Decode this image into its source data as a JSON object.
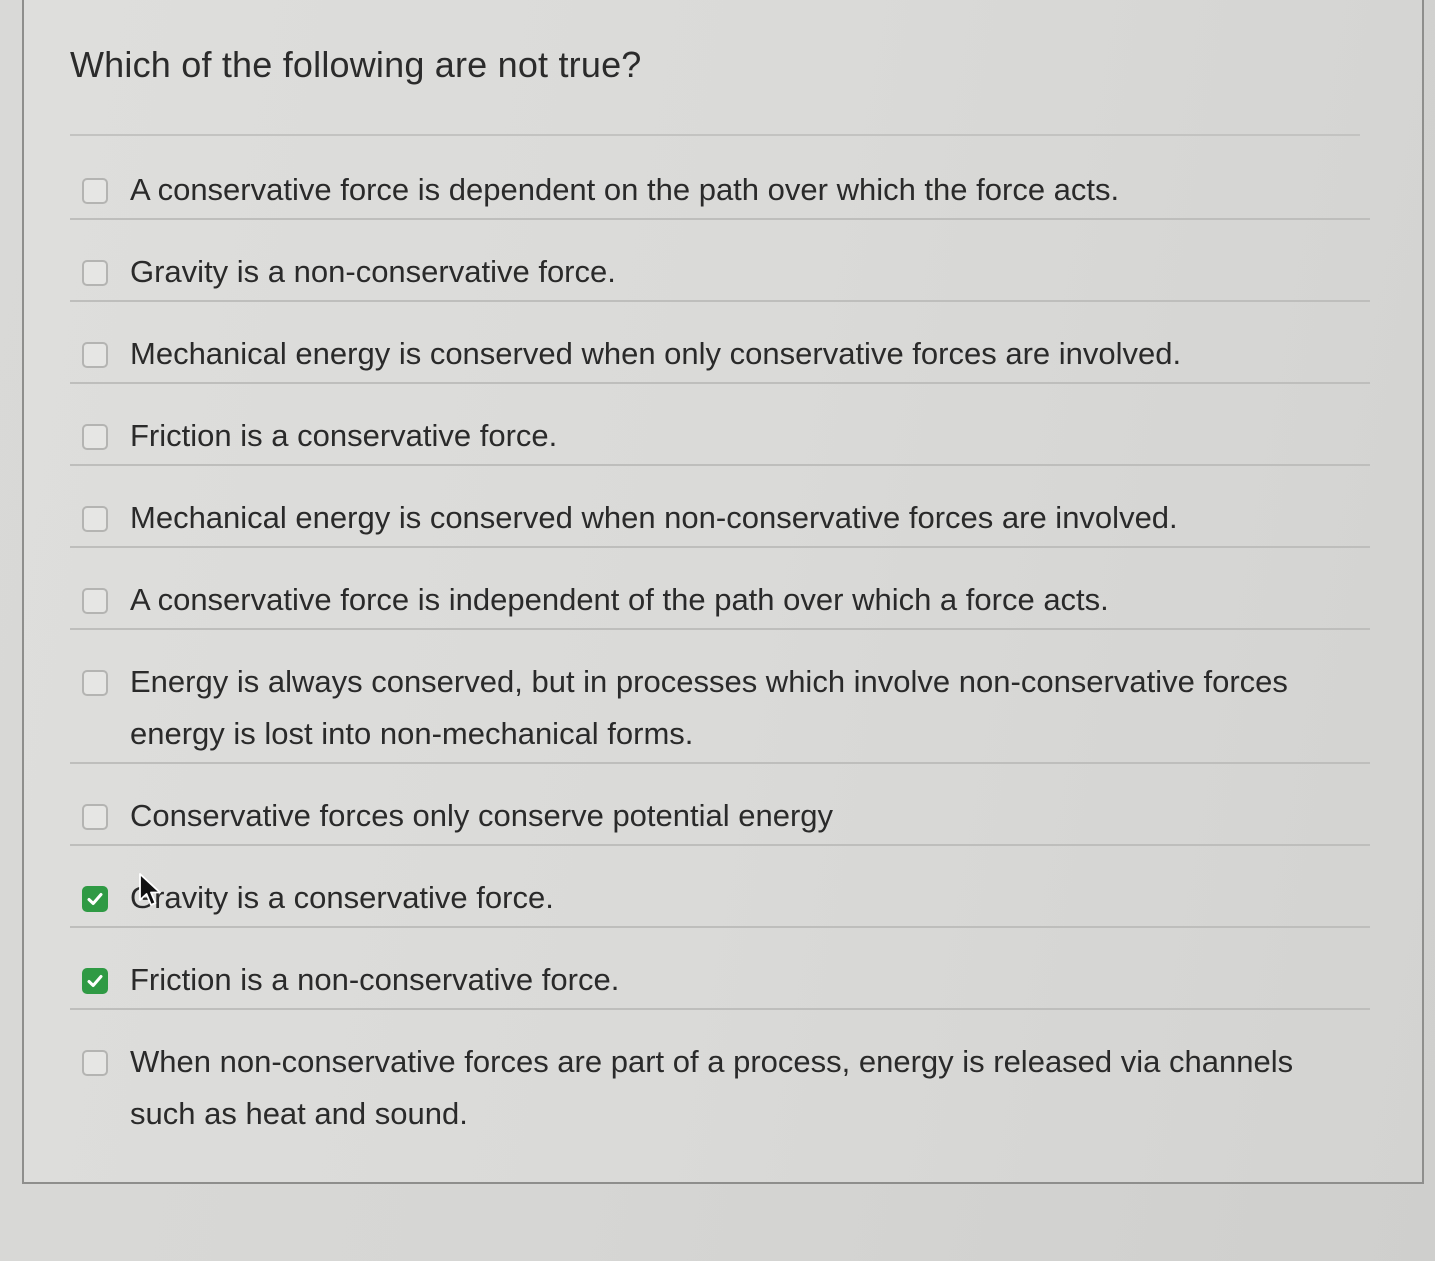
{
  "question": {
    "title": "Which of the following are not true?"
  },
  "options": [
    {
      "text": "A conservative force is dependent on the path over which the force acts.",
      "checked": false
    },
    {
      "text": "Gravity is a non-conservative force.",
      "checked": false
    },
    {
      "text": "Mechanical energy is conserved when only conservative forces are involved.",
      "checked": false
    },
    {
      "text": "Friction is a conservative force.",
      "checked": false
    },
    {
      "text": "Mechanical energy is conserved when non-conservative forces are involved.",
      "checked": false
    },
    {
      "text": "A conservative force is independent of the path over which a force acts.",
      "checked": false
    },
    {
      "text": "Energy is always conserved, but in processes which involve non-conservative forces energy is lost into non-mechanical forms.",
      "checked": false
    },
    {
      "text": "Conservative forces only conserve potential energy",
      "checked": false
    },
    {
      "text": "Gravity is a conservative force.",
      "checked": true
    },
    {
      "text": "Friction is a non-conservative force.",
      "checked": true
    },
    {
      "text": "When non-conservative forces are part of a process, energy is released via channels such as heat and sound.",
      "checked": false
    }
  ],
  "colors": {
    "checked": "#2f9a44",
    "text": "#2a2a2a"
  },
  "icons": {
    "checkmark": "checkmark-icon",
    "cursor": "mouse-pointer-icon"
  }
}
